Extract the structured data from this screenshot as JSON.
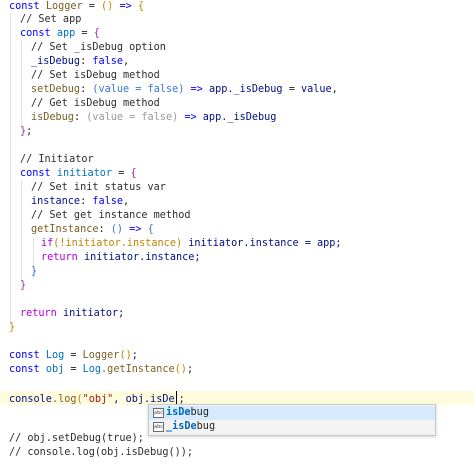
{
  "editor": {
    "code_lines": {
      "l1": {
        "kw": "const",
        "name": "Logger",
        "eq": "=",
        "args": "()",
        "arrow": "=>",
        "brace": "{"
      },
      "l2": "// Set app",
      "l3": {
        "kw": "const",
        "name": "app",
        "eq": "=",
        "brace": "{"
      },
      "l4": "// Set _isDebug option",
      "l5": {
        "prop": "_isDebug",
        "colon": ":",
        "value": "false",
        "comma": ","
      },
      "l6": "// Set isDebug method",
      "l7": {
        "prop": "setDebug",
        "colon": ":",
        "params": "(value = false)",
        "arrow": "=>",
        "obj": "app",
        "member": "._isDebug",
        "eq": "=",
        "rhs": "value",
        "comma": ","
      },
      "l8": "// Get isDebug method",
      "l9": {
        "prop": "isDebug",
        "colon": ":",
        "params": "(value = false)",
        "arrow": "=>",
        "obj": "app",
        "member": "._isDebug"
      },
      "l10": {
        "brace": "}",
        "semi": ";"
      },
      "l12": "// Initiator",
      "l13": {
        "kw": "const",
        "name": "initiator",
        "eq": "=",
        "brace": "{"
      },
      "l14": "// Set init status var",
      "l15": {
        "prop": "instance",
        "colon": ":",
        "value": "false",
        "comma": ","
      },
      "l16": "// Set get instance method",
      "l17": {
        "prop": "getInstance",
        "colon": ":",
        "args": "()",
        "arrow": "=>",
        "brace": "{"
      },
      "l18": {
        "kw": "if",
        "cond": "(!initiator.instance)",
        "body": "initiator.instance = app;"
      },
      "l19": {
        "kw": "return",
        "body": "initiator.instance;"
      },
      "l20": {
        "brace": "}"
      },
      "l21": {
        "brace": "}"
      },
      "l23": {
        "kw": "return",
        "body": "initiator;"
      },
      "l24": {
        "brace": "}"
      },
      "l26": {
        "kw": "const",
        "name": "Log",
        "eq": "=",
        "call": "Logger",
        "args": "()",
        "semi": ";"
      },
      "l27": {
        "kw": "const",
        "name": "obj",
        "eq": "=",
        "obj": "Log",
        "call": ".getInstance",
        "args": "()",
        "semi": ";"
      },
      "l29": {
        "obj": "console",
        "call": ".log",
        "open": "(",
        "str": "\"obj\"",
        "mid": ", obj.isDe",
        "after": ";"
      },
      "l32": "// obj.setDebug(true);",
      "l33": "// console.log(obj.isDebug());"
    }
  },
  "suggest": {
    "items": [
      {
        "kind_icon": "abc",
        "match": "isDe",
        "rest": "bug"
      },
      {
        "kind_icon": "abc",
        "match": "_isDe",
        "rest": "bug"
      }
    ],
    "selected_index": 0
  }
}
